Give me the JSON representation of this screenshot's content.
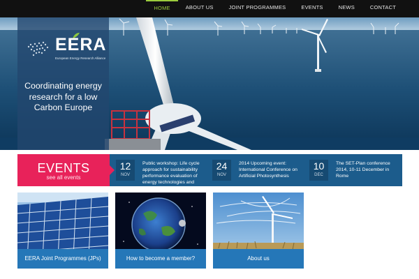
{
  "nav": {
    "items": [
      {
        "label": "HOME",
        "active": true
      },
      {
        "label": "ABOUT US",
        "active": false
      },
      {
        "label": "JOINT PROGRAMMES",
        "active": false
      },
      {
        "label": "EVENTS",
        "active": false
      },
      {
        "label": "NEWS",
        "active": false
      },
      {
        "label": "CONTACT",
        "active": false
      }
    ]
  },
  "hero": {
    "logo_text": "EERA",
    "logo_subtitle": "European Energy Research Alliance",
    "tagline": "Coordinating energy research for a low Carbon Europe"
  },
  "events": {
    "title": "EVENTS",
    "see_all": "see all events",
    "items": [
      {
        "day": "12",
        "month": "NOV",
        "text": "Public workshop: Life cycle approach for sustainability performance evaluation of energy technologies and"
      },
      {
        "day": "24",
        "month": "NOV",
        "text": "2014 Upcoming event: International Conference on Artificial Photosynthesis"
      },
      {
        "day": "10",
        "month": "DEC",
        "text": "The SET-Plan conference 2014, 10-11 December in Rome"
      }
    ]
  },
  "tiles": [
    {
      "label": "EERA Joint Programmes (JPs)",
      "icon": "solar-panels-image"
    },
    {
      "label": "How to become a member?",
      "icon": "earth-image"
    },
    {
      "label": "About us",
      "icon": "wind-turbine-image"
    }
  ],
  "colors": {
    "nav_bg": "#111111",
    "nav_active": "#9ccc3d",
    "events_accent": "#e8225a",
    "events_bar": "#1c5c8c",
    "tile_label": "#2577b8"
  }
}
